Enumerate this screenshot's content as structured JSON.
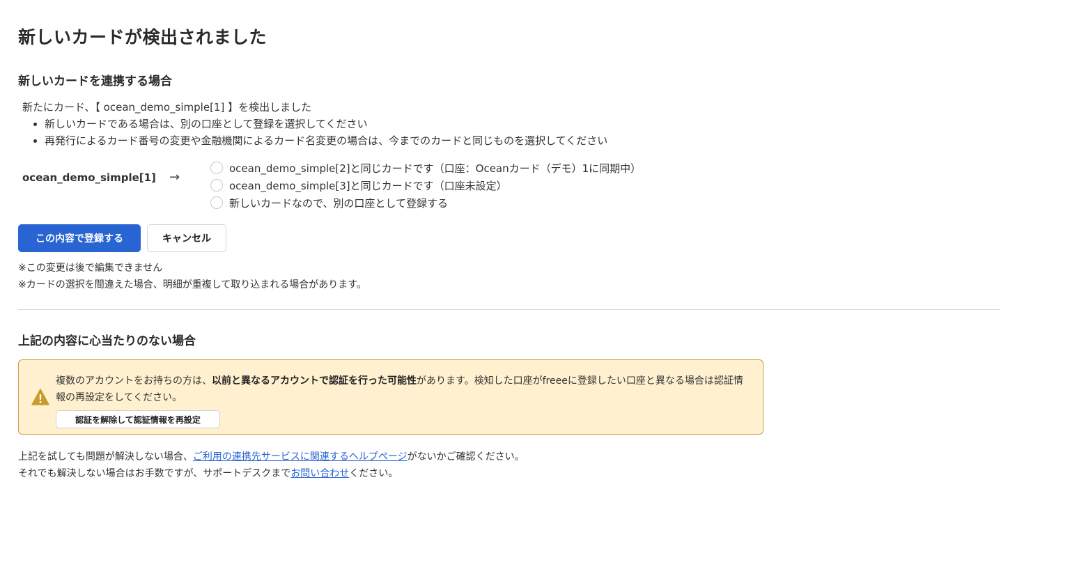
{
  "page": {
    "title": "新しいカードが検出されました"
  },
  "link_section": {
    "heading": "新しいカードを連携する場合",
    "intro": "新たにカード、【 ocean_demo_simple[1] 】を検出しました",
    "bullets": [
      "新しいカードである場合は、別の口座として登録を選択してください",
      "再発行によるカード番号の変更や金融機関によるカード名変更の場合は、今までのカードと同じものを選択してください"
    ],
    "detected_card": "ocean_demo_simple[1]",
    "arrow": "→",
    "options": [
      {
        "label": "ocean_demo_simple[2]と同じカードです（口座：Oceanカード（デモ）1に同期中）",
        "selected": false
      },
      {
        "label": "ocean_demo_simple[3]と同じカードです（口座未設定）",
        "selected": false
      },
      {
        "label": "新しいカードなので、別の口座として登録する",
        "selected": false
      }
    ],
    "submit_label": "この内容で登録する",
    "cancel_label": "キャンセル",
    "notes": [
      "※この変更は後で編集できません",
      "※カードの選択を間違えた場合、明細が重複して取り込まれる場合があります。"
    ]
  },
  "unknown_section": {
    "heading": "上記の内容に心当たりのない場合",
    "warning": {
      "text_before": "複数のアカウントをお持ちの方は、",
      "text_bold": "以前と異なるアカウントで認証を行った可能性",
      "text_after": "があります。検知した口座がfreeeに登録したい口座と異なる場合は認証情報の再設定をしてください。",
      "button_label": "認証を解除して認証情報を再設定",
      "icon": "warning-triangle-icon",
      "icon_color": "#c99a2e"
    },
    "footer": {
      "line1_before": "上記を試しても問題が解決しない場合、",
      "line1_link": "ご利用の連携先サービスに関連するヘルプページ",
      "line1_after": "がないかご確認ください。",
      "line2_before": "それでも解決しない場合はお手数ですが、サポートデスクまで",
      "line2_link": "お問い合わせ",
      "line2_after": "ください。"
    }
  },
  "colors": {
    "primary": "#2864d2",
    "warning_bg": "#fff0cf",
    "warning_border": "#c9a046",
    "link": "#2864d2"
  }
}
